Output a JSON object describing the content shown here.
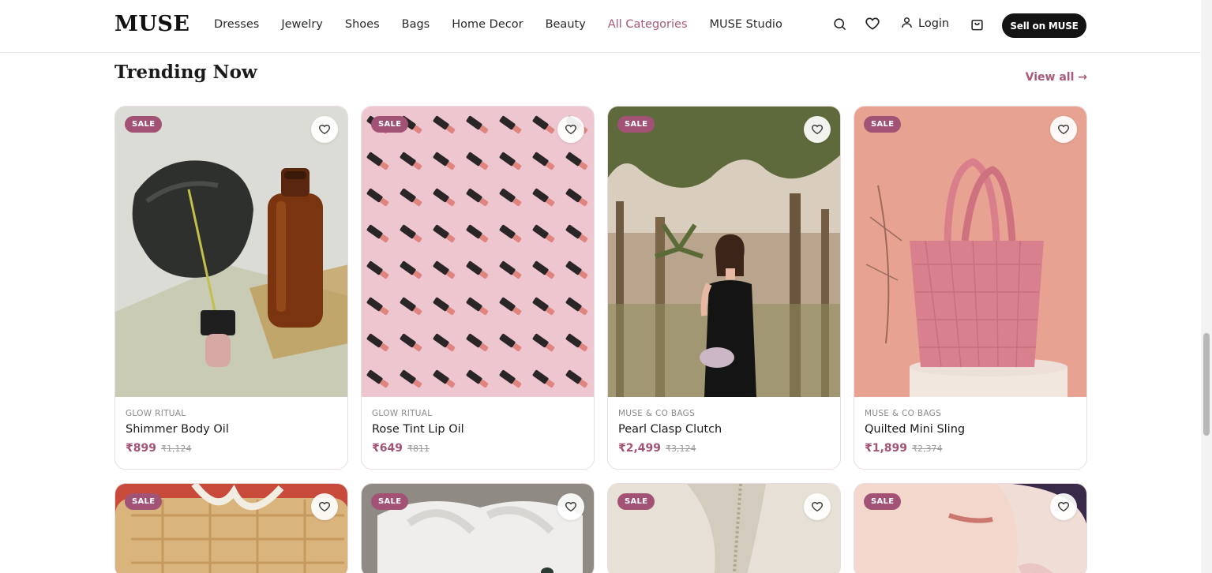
{
  "header": {
    "logo": "MUSE",
    "nav": [
      "Dresses",
      "Jewelry",
      "Shoes",
      "Bags",
      "Home Decor",
      "Beauty",
      "All Categories",
      "MUSE Studio"
    ],
    "login_label": "Login",
    "sell_label": "Sell on MUSE"
  },
  "section": {
    "title": "Trending Now",
    "view_all": "View all →"
  },
  "products": [
    {
      "badge": "SALE",
      "brand": "GLOW RITUAL",
      "name": "Shimmer Body Oil",
      "price": "₹899",
      "old_price": "₹1,124"
    },
    {
      "badge": "SALE",
      "brand": "GLOW RITUAL",
      "name": "Rose Tint Lip Oil",
      "price": "₹649",
      "old_price": "₹811"
    },
    {
      "badge": "SALE",
      "brand": "MUSE & CO BAGS",
      "name": "Pearl Clasp Clutch",
      "price": "₹2,499",
      "old_price": "₹3,124"
    },
    {
      "badge": "SALE",
      "brand": "MUSE & CO BAGS",
      "name": "Quilted Mini Sling",
      "price": "₹1,899",
      "old_price": "₹2,374"
    }
  ],
  "products_row2": [
    {
      "badge": "SALE"
    },
    {
      "badge": "SALE"
    },
    {
      "badge": "SALE"
    },
    {
      "badge": "SALE"
    }
  ],
  "colors": {
    "accent": "#a8587a",
    "badge": "#a25375",
    "button": "#141414"
  },
  "icons": {
    "search": "search-icon",
    "wishlist": "heart-icon",
    "user": "user-icon",
    "cart": "shopping-bag-icon"
  }
}
